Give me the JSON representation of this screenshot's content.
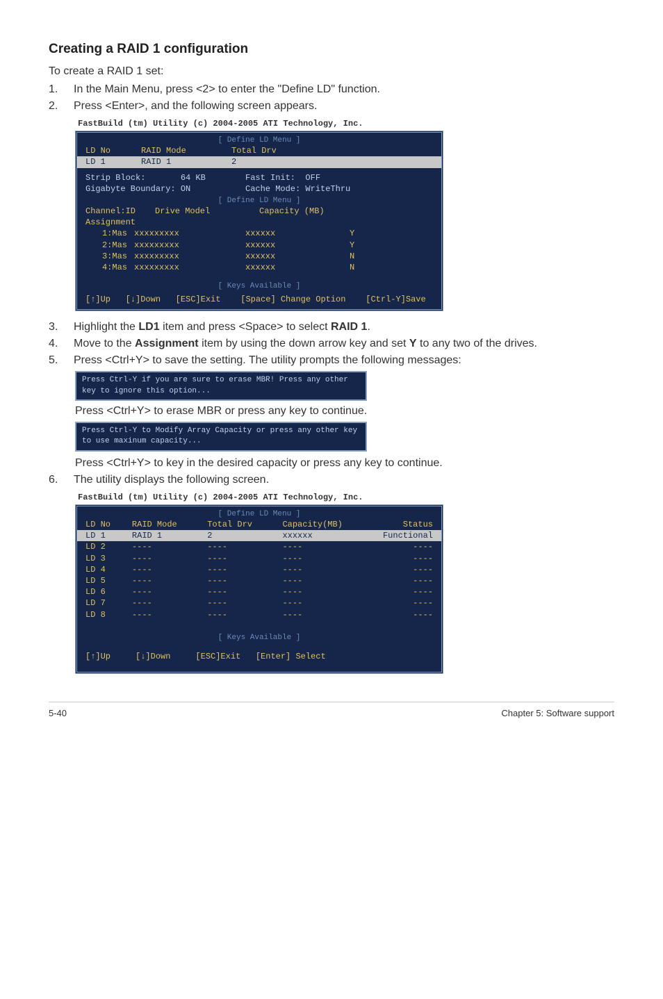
{
  "heading": "Creating a RAID 1 configuration",
  "intro": "To create a RAID 1 set:",
  "steps": {
    "s1": "In the Main Menu, press <2> to enter the \"Define LD\" function.",
    "s2": "Press <Enter>, and the following screen appears.",
    "s3": "Highlight the LD1 item and press <Space> to select RAID 1.",
    "s4": "Move to the Assignment item by using the down arrow key and set Y to any two of the drives.",
    "s5": "Press <Ctrl+Y> to save the setting. The utility prompts the following messages:",
    "s5b": "Press <Ctrl+Y> to erase MBR or press any key to continue.",
    "s5c": "Press <Ctrl+Y> to key in the desired capacity or press any key to continue.",
    "s6": "The utility displays the following screen."
  },
  "term1": {
    "title": "FastBuild (tm) Utility (c) 2004-2005 ATI Technology, Inc.",
    "sect1": "[ Define LD Menu ]",
    "hdr_ldno": "LD No",
    "hdr_mode": "RAID Mode",
    "hdr_drv": "Total Drv",
    "sel_ld": "LD 1",
    "sel_mode": "RAID 1",
    "sel_drv": "2",
    "strip": "Strip Block:       64 KB",
    "fast": "Fast Init:  OFF",
    "gig": "Gigabyte Boundary: ON",
    "cache": "Cache Mode: WriteThru",
    "sect2": "[ Define LD Menu ]",
    "h_chan": "Channel:ID",
    "h_model": "Drive Model",
    "h_cap": "Capacity (MB)",
    "assign": "Assignment",
    "rows": [
      {
        "ch": "1:Mas",
        "model": "xxxxxxxxx",
        "cap": "xxxxxx",
        "a": "Y"
      },
      {
        "ch": "2:Mas",
        "model": "xxxxxxxxx",
        "cap": "xxxxxx",
        "a": "Y"
      },
      {
        "ch": "3:Mas",
        "model": "xxxxxxxxx",
        "cap": "xxxxxx",
        "a": "N"
      },
      {
        "ch": "4:Mas",
        "model": "xxxxxxxxx",
        "cap": "xxxxxx",
        "a": "N"
      }
    ],
    "sect3": "[ Keys Available ]",
    "keys": "[↑]Up   [↓]Down   [ESC]Exit    [Space] Change Option    [Ctrl-Y]Save"
  },
  "prompt1": "Press Ctrl-Y if you are sure to erase MBR! Press any other key to ignore this option...",
  "prompt2": "Press Ctrl-Y to Modify Array Capacity or press any other key to use maxinum capacity...",
  "term2": {
    "title": "FastBuild (tm) Utility (c) 2004-2005 ATI Technology, Inc.",
    "sect1": "[ Define LD Menu ]",
    "h_ldno": "LD No",
    "h_mode": "RAID Mode",
    "h_drv": "Total Drv",
    "h_cap": "Capacity(MB)",
    "h_status": "Status",
    "sel_ld": "LD 1",
    "sel_mode": "RAID 1",
    "sel_drv": "2",
    "sel_cap": "xxxxxx",
    "sel_status": "Functional",
    "rows": [
      {
        "ld": "LD 2",
        "m": "----",
        "d": "----",
        "c": "----",
        "s": "----"
      },
      {
        "ld": "LD 3",
        "m": "----",
        "d": "----",
        "c": "----",
        "s": "----"
      },
      {
        "ld": "LD 4",
        "m": "----",
        "d": "----",
        "c": "----",
        "s": "----"
      },
      {
        "ld": "LD 5",
        "m": "----",
        "d": "----",
        "c": "----",
        "s": "----"
      },
      {
        "ld": "LD 6",
        "m": "----",
        "d": "----",
        "c": "----",
        "s": "----"
      },
      {
        "ld": "LD 7",
        "m": "----",
        "d": "----",
        "c": "----",
        "s": "----"
      },
      {
        "ld": "LD 8",
        "m": "----",
        "d": "----",
        "c": "----",
        "s": "----"
      }
    ],
    "sect2": "[ Keys Available ]",
    "keys": "[↑]Up     [↓]Down     [ESC]Exit   [Enter] Select"
  },
  "footer_left": "5-40",
  "footer_right": "Chapter 5: Software support"
}
